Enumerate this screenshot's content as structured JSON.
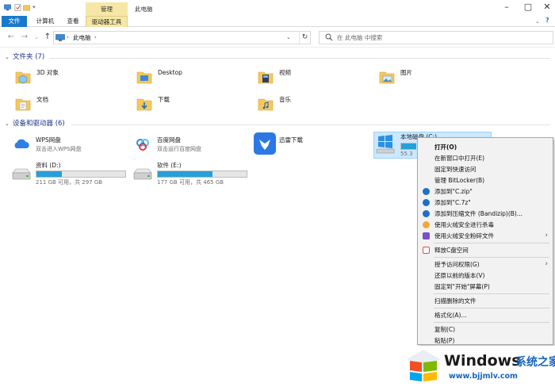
{
  "titlebar": {
    "context_tab_header": "管理",
    "window_title": "此电脑"
  },
  "ribbon": {
    "tabs": [
      {
        "label": "文件"
      },
      {
        "label": "计算机"
      },
      {
        "label": "查看"
      },
      {
        "label": "驱动器工具"
      }
    ]
  },
  "address": {
    "path": "此电脑",
    "separator": "›"
  },
  "search": {
    "placeholder": "在 此电脑 中搜索"
  },
  "folders_section": {
    "title": "文件夹 (7)",
    "items": [
      {
        "label": "3D 对象",
        "icon": "3d-objects-folder-icon"
      },
      {
        "label": "Desktop",
        "icon": "desktop-folder-icon"
      },
      {
        "label": "视频",
        "icon": "videos-folder-icon"
      },
      {
        "label": "图片",
        "icon": "pictures-folder-icon"
      },
      {
        "label": "文档",
        "icon": "documents-folder-icon"
      },
      {
        "label": "下载",
        "icon": "downloads-folder-icon"
      },
      {
        "label": "音乐",
        "icon": "music-folder-icon"
      }
    ]
  },
  "devices_section": {
    "title": "设备和驱动器 (6)",
    "apps": [
      {
        "label": "WPS网盘",
        "sub": "双击进入WPS网盘",
        "icon": "wps-cloud-icon"
      },
      {
        "label": "百度网盘",
        "sub": "双击运行百度网盘",
        "icon": "baidu-netdisk-icon"
      },
      {
        "label": "迅雷下载",
        "sub": "",
        "icon": "xunlei-icon"
      }
    ],
    "drives": [
      {
        "label": "资料 (D:)",
        "info": "211 GB 可用，共 297 GB",
        "used_fraction": 0.29
      },
      {
        "label": "软件 (E:)",
        "info": "177 GB 可用，共 465 GB",
        "used_fraction": 0.62
      }
    ],
    "drive_c": {
      "label": "本地磁盘 (C:)",
      "info": "55.3",
      "used_fraction": 0.55
    }
  },
  "context_menu": {
    "items": [
      {
        "label": "打开(O)",
        "bold": true
      },
      {
        "label": "在新窗口中打开(E)"
      },
      {
        "label": "固定到快速访问"
      },
      {
        "label": "管理 BitLocker(B)"
      },
      {
        "label": "添加到\"C.zip\"",
        "icon_color": "#1f6fc5"
      },
      {
        "label": "添加到\"C.7z\"",
        "icon_color": "#1f6fc5"
      },
      {
        "label": "添加到压缩文件 (Bandizip)(B)...",
        "icon_color": "#1f6fc5"
      },
      {
        "label": "使用火绒安全进行杀毒",
        "icon_color": "#f3a73b"
      },
      {
        "label": "使用火绒安全粉碎文件",
        "icon_color": "#7b4fc9",
        "submenu": true
      },
      {
        "label": "释放C盘空间",
        "icon_color": "#e04b4b"
      },
      {
        "label": "授予访问权限(G)",
        "submenu": true
      },
      {
        "label": "还原以前的版本(V)"
      },
      {
        "label": "固定到\"开始\"屏幕(P)"
      },
      {
        "label": "扫描删除的文件"
      },
      {
        "label": "格式化(A)..."
      },
      {
        "label": "复制(C)"
      },
      {
        "label": "粘贴(P)"
      }
    ]
  },
  "watermark": {
    "brand": "Windows",
    "cn": "系统之家",
    "url": "www.bjjmlv.com"
  },
  "colors": {
    "accent": "#1979ca",
    "drive_fill": "#26a0da",
    "context_tab": "#f6e7a6",
    "selection": "#cce8ff"
  }
}
